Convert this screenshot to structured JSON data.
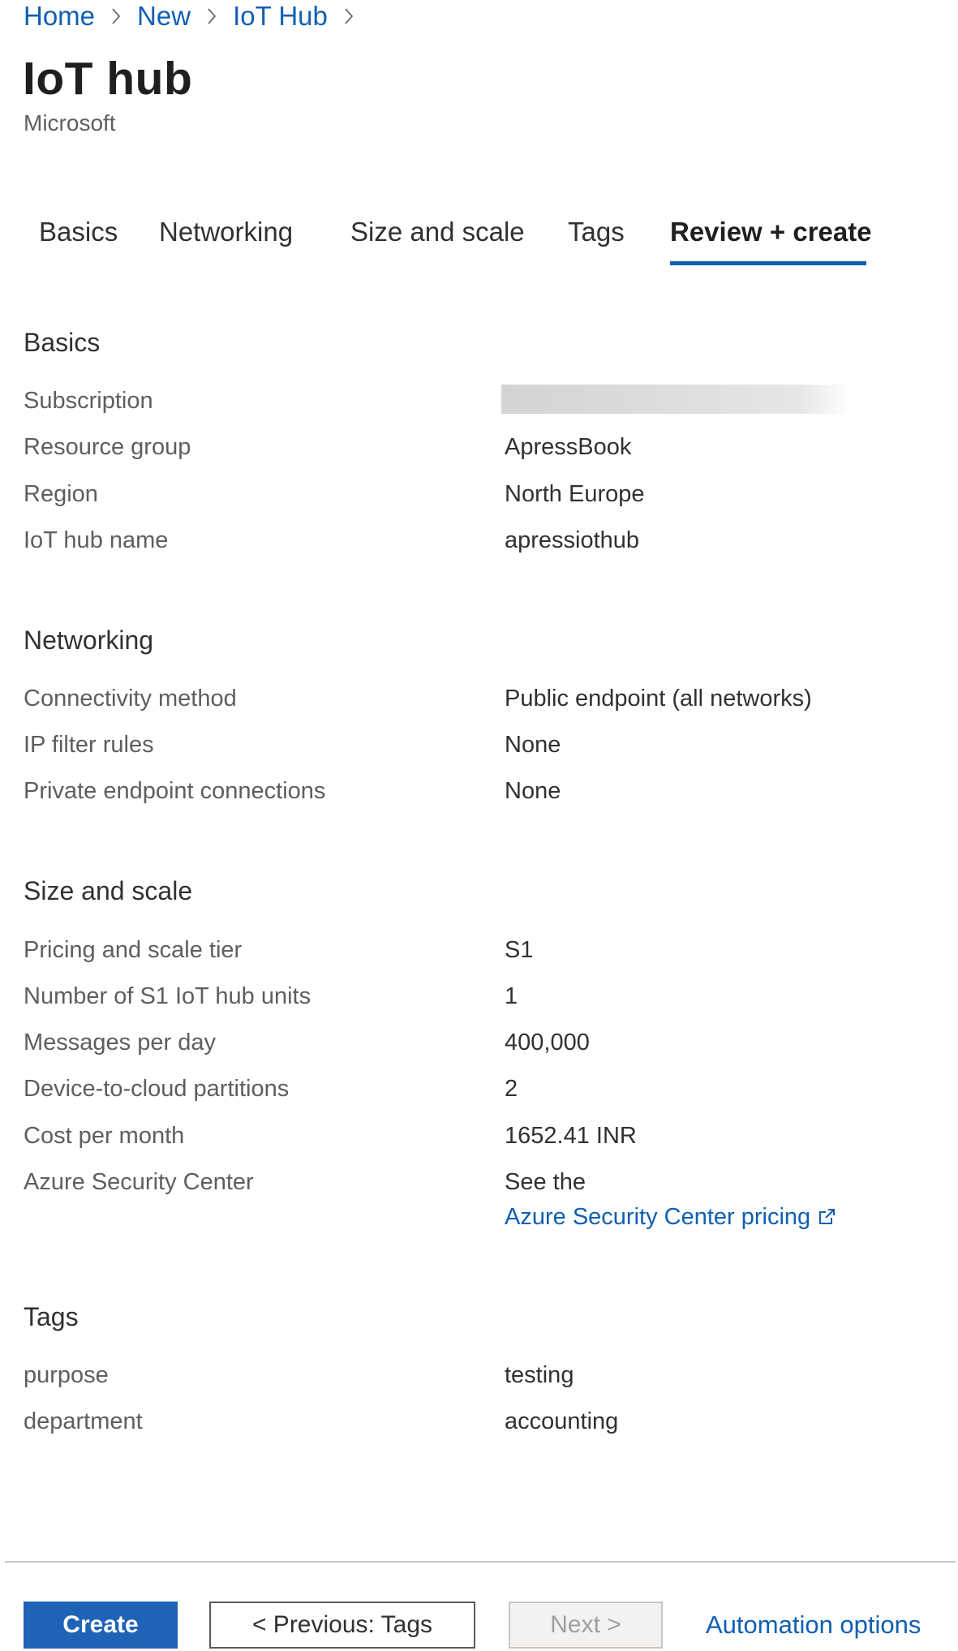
{
  "breadcrumb": [
    "Home",
    "New",
    "IoT Hub"
  ],
  "header": {
    "title": "IoT hub",
    "publisher": "Microsoft"
  },
  "tabs": [
    {
      "label": "Basics",
      "active": false
    },
    {
      "label": "Networking",
      "active": false
    },
    {
      "label": "Size and scale",
      "active": false
    },
    {
      "label": "Tags",
      "active": false
    },
    {
      "label": "Review + create",
      "active": true
    }
  ],
  "sections": {
    "basics": {
      "title": "Basics",
      "rows": [
        {
          "label": "Subscription",
          "value": ""
        },
        {
          "label": "Resource group",
          "value": "ApressBook"
        },
        {
          "label": "Region",
          "value": "North Europe"
        },
        {
          "label": "IoT hub name",
          "value": "apressiothub"
        }
      ]
    },
    "networking": {
      "title": "Networking",
      "rows": [
        {
          "label": "Connectivity method",
          "value": "Public endpoint (all networks)"
        },
        {
          "label": "IP filter rules",
          "value": "None"
        },
        {
          "label": "Private endpoint connections",
          "value": "None"
        }
      ]
    },
    "size": {
      "title": "Size and scale",
      "rows": [
        {
          "label": "Pricing and scale tier",
          "value": "S1"
        },
        {
          "label": "Number of S1 IoT hub units",
          "value": "1"
        },
        {
          "label": "Messages per day",
          "value": "400,000"
        },
        {
          "label": "Device-to-cloud partitions",
          "value": "2"
        },
        {
          "label": "Cost per month",
          "value": "1652.41 INR"
        },
        {
          "label": "Azure Security Center",
          "value": "See the",
          "link": "Azure Security Center pricing"
        }
      ]
    },
    "tags": {
      "title": "Tags",
      "rows": [
        {
          "label": "purpose",
          "value": "testing"
        },
        {
          "label": "department",
          "value": "accounting"
        }
      ]
    }
  },
  "footer": {
    "create_label": "Create",
    "previous_label": "< Previous: Tags",
    "next_label": "Next >",
    "automation_label": "Automation options"
  },
  "colors": {
    "link": "#0f5fb3",
    "primary_button": "#1f63b6",
    "tab_underline": "#0f5fb3"
  },
  "icons": {
    "breadcrumb_separator": "chevron-right-icon",
    "external_link": "external-link-icon"
  }
}
